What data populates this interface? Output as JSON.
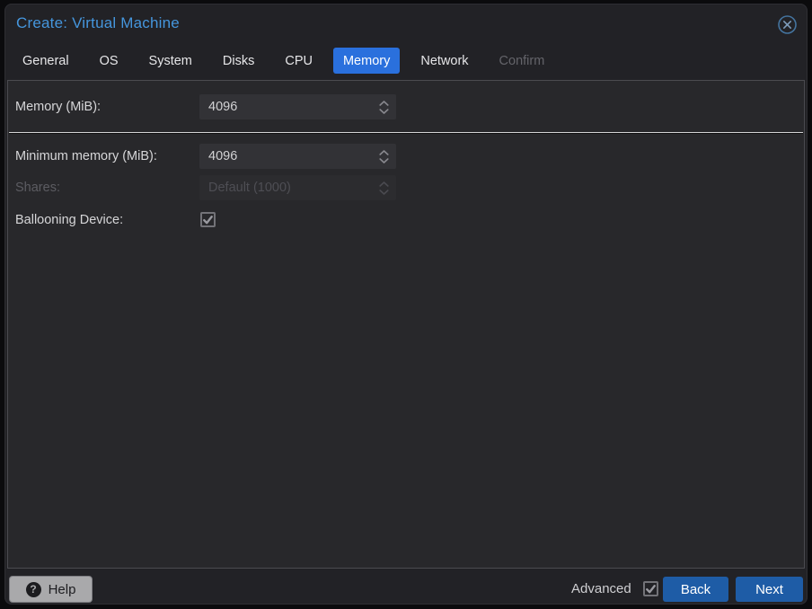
{
  "dialog": {
    "title": "Create: Virtual Machine",
    "close_icon": "circle-x-icon"
  },
  "tabs": [
    {
      "label": "General",
      "state": "normal"
    },
    {
      "label": "OS",
      "state": "normal"
    },
    {
      "label": "System",
      "state": "normal"
    },
    {
      "label": "Disks",
      "state": "normal"
    },
    {
      "label": "CPU",
      "state": "normal"
    },
    {
      "label": "Memory",
      "state": "active"
    },
    {
      "label": "Network",
      "state": "normal"
    },
    {
      "label": "Confirm",
      "state": "disabled"
    }
  ],
  "form": {
    "rows": [
      {
        "label": "Memory (MiB):",
        "type": "number-spinner",
        "value": "4096",
        "disabled": false
      },
      {
        "label": "Minimum memory (MiB):",
        "type": "number-spinner",
        "value": "4096",
        "disabled": false
      },
      {
        "label": "Shares:",
        "type": "number-spinner",
        "value": "Default (1000)",
        "disabled": true
      },
      {
        "label": "Ballooning Device:",
        "type": "checkbox",
        "checked": true,
        "disabled": false
      }
    ]
  },
  "footer": {
    "help_label": "Help",
    "help_icon_glyph": "?",
    "advanced_label": "Advanced",
    "advanced_checked": true,
    "back_label": "Back",
    "next_label": "Next"
  },
  "colors": {
    "title_blue": "#4596dd",
    "active_tab_blue": "#2a70dd",
    "button_blue": "#1e5ca6",
    "dialog_bg": "#222226",
    "panel_bg": "#28282b",
    "field_bg": "#323236",
    "overlay_bg": "#0b0b0d"
  }
}
